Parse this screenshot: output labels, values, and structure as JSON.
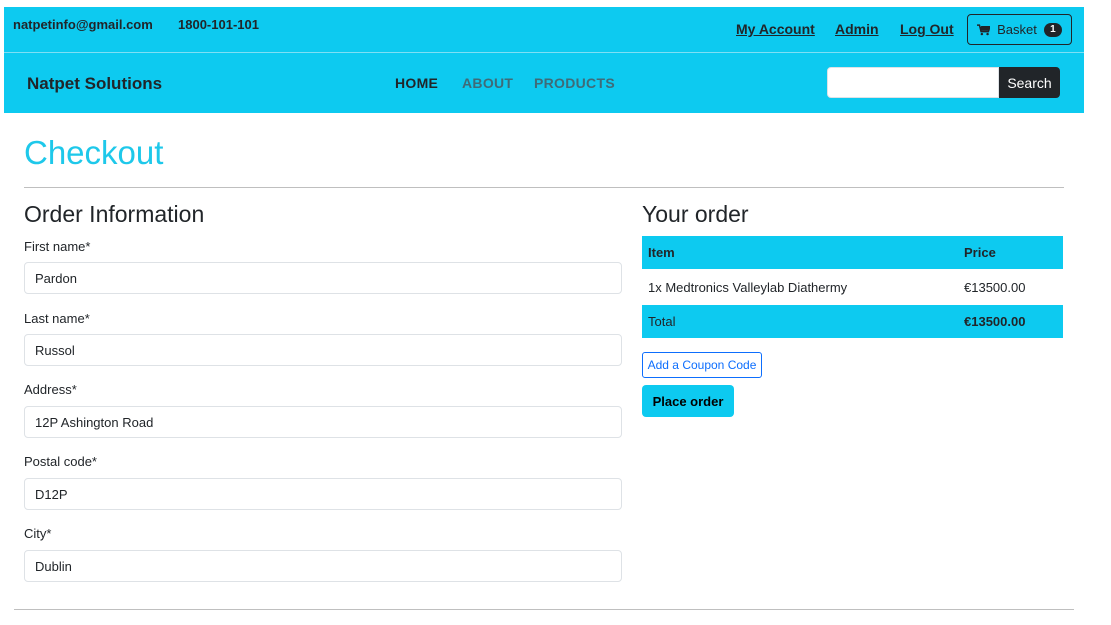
{
  "topbar": {
    "email": "natpetinfo@gmail.com",
    "phone": "1800-101-101",
    "links": {
      "my_account": "My Account",
      "admin": "Admin",
      "logout": "Log Out"
    },
    "basket": {
      "icon": "cart-icon",
      "label": "Basket",
      "count": "1"
    }
  },
  "navbar": {
    "brand": "Natpet Solutions",
    "links": {
      "home": "HOME",
      "about": "ABOUT",
      "products": "PRODUCTS"
    },
    "search": {
      "value": "",
      "button": "Search"
    }
  },
  "page": {
    "title": "Checkout"
  },
  "order_info": {
    "title": "Order Information",
    "fields": {
      "first_name": {
        "label": "First name*",
        "value": "Pardon"
      },
      "last_name": {
        "label": "Last name*",
        "value": "Russol"
      },
      "address": {
        "label": "Address*",
        "value": "12P Ashington Road"
      },
      "postal_code": {
        "label": "Postal code*",
        "value": "D12P"
      },
      "city": {
        "label": "City*",
        "value": "Dublin"
      }
    }
  },
  "your_order": {
    "title": "Your order",
    "headers": {
      "item": "Item",
      "price": "Price"
    },
    "items": [
      {
        "name": "1x Medtronics Valleylab Diathermy",
        "price": "€13500.00"
      }
    ],
    "total": {
      "label": "Total",
      "value": "€13500.00"
    },
    "coupon_button": "Add a Coupon Code",
    "place_order_button": "Place order"
  },
  "colors": {
    "accent": "#0dcaf0",
    "title": "#1ec8ea",
    "dark": "#212529",
    "link_blue": "#0d6efd"
  }
}
